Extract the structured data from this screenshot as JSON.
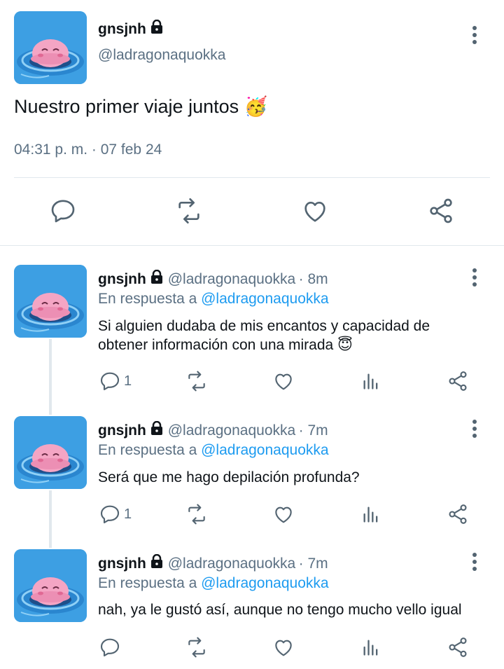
{
  "main_tweet": {
    "display_name": "gnsjnh",
    "handle": "@ladragonaquokka",
    "text": "Nuestro primer viaje juntos",
    "emoji": "🥳",
    "timestamp": "04:31 p. m. · 07 feb 24"
  },
  "replies": [
    {
      "display_name": "gnsjnh",
      "handle": "@ladragonaquokka",
      "time": "· 8m",
      "reply_prefix": "En respuesta a",
      "reply_to": "@ladragonaquokka",
      "text_line1": "Si alguien dudaba de mis encantos y capacidad de",
      "text_line2": "obtener información con una mirada",
      "emoji": "😇",
      "reply_count": "1"
    },
    {
      "display_name": "gnsjnh",
      "handle": "@ladragonaquokka",
      "time": "· 7m",
      "reply_prefix": "En respuesta a",
      "reply_to": "@ladragonaquokka",
      "text_line1": "Será que me hago depilación profunda?",
      "reply_count": "1"
    },
    {
      "display_name": "gnsjnh",
      "handle": "@ladragonaquokka",
      "time": "· 7m",
      "reply_prefix": "En respuesta a",
      "reply_to": "@ladragonaquokka",
      "text_line1": "nah, ya le gustó así, aunque no tengo mucho vello igual",
      "reply_count": ""
    }
  ],
  "colors": {
    "link": "#1d9bf0",
    "muted": "#5b7083",
    "icon": "#536471",
    "divider": "#e1e8ed"
  }
}
